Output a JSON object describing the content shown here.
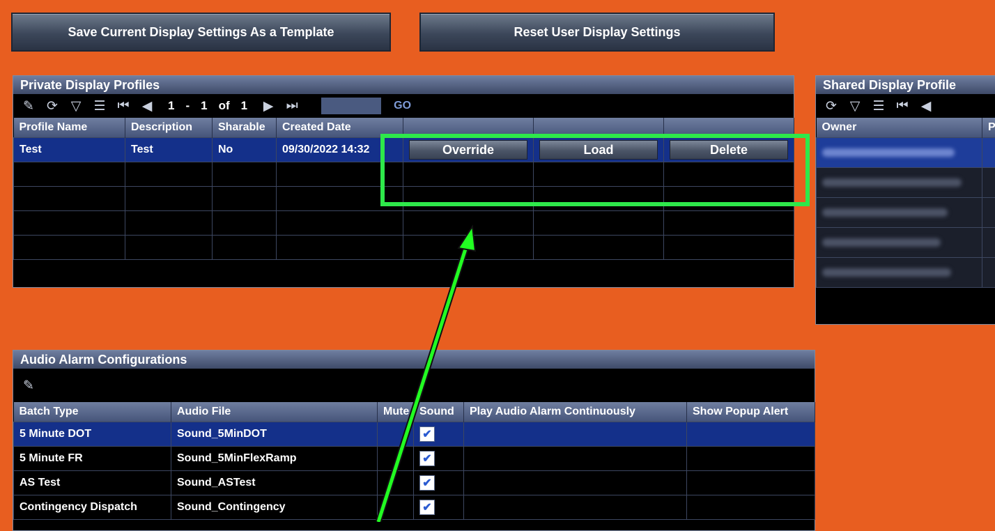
{
  "top_buttons": {
    "save_template": "Save Current Display Settings As a Template",
    "reset_settings": "Reset User Display Settings"
  },
  "private_panel": {
    "title": "Private Display Profiles",
    "pager": {
      "from": "1",
      "dash": "-",
      "to": "1",
      "of": "of",
      "total": "1",
      "go": "GO"
    },
    "columns": [
      "Profile Name",
      "Description",
      "Sharable",
      "Created Date"
    ],
    "rows": [
      {
        "name": "Test",
        "description": "Test",
        "sharable": "No",
        "created": "09/30/2022 14:32"
      }
    ],
    "actions": {
      "override": "Override",
      "load": "Load",
      "delete": "Delete"
    }
  },
  "shared_panel": {
    "title": "Shared Display Profile",
    "columns": [
      "Owner",
      "P"
    ]
  },
  "audio_panel": {
    "title": "Audio Alarm Configurations",
    "columns": [
      "Batch Type",
      "Audio File",
      "Mute",
      "Sound",
      "Play Audio Alarm Continuously",
      "Show Popup Alert"
    ],
    "rows": [
      {
        "batch": "5 Minute DOT",
        "file": "Sound_5MinDOT",
        "sound": true
      },
      {
        "batch": "5 Minute FR",
        "file": "Sound_5MinFlexRamp",
        "sound": true
      },
      {
        "batch": "AS Test",
        "file": "Sound_ASTest",
        "sound": true
      },
      {
        "batch": "Contingency Dispatch",
        "file": "Sound_Contingency",
        "sound": true
      }
    ]
  },
  "annotation": {
    "highlight_color": "#2ee84a",
    "arrow_color": "#22ff22"
  },
  "icons": [
    "pencil-icon",
    "refresh-icon",
    "filter-icon",
    "columns-icon",
    "first-page-icon",
    "prev-page-icon",
    "next-page-icon",
    "last-page-icon",
    "checkbox-checked-icon"
  ]
}
